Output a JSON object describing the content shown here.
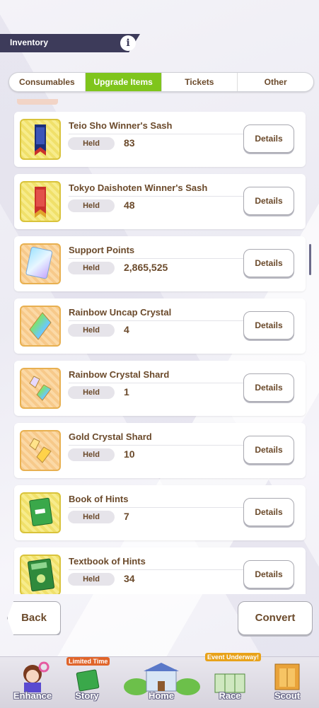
{
  "header": {
    "title": "Inventory",
    "info_icon": "i"
  },
  "tabs": [
    {
      "label": "Consumables",
      "active": false
    },
    {
      "label": "Upgrade Items",
      "active": true
    },
    {
      "label": "Tickets",
      "active": false
    },
    {
      "label": "Other",
      "active": false
    }
  ],
  "accent_color": "#7fc51c",
  "text_color": "#6b4a2b",
  "held_label": "Held",
  "details_label": "Details",
  "items": [
    {
      "name": "Teio Sho Winner's Sash",
      "count": "83",
      "icon": "sash-icon"
    },
    {
      "name": "Tokyo Daishoten Winner's Sash",
      "count": "48",
      "icon": "sash-icon"
    },
    {
      "name": "Support Points",
      "count": "2,865,525",
      "icon": "support-card-icon"
    },
    {
      "name": "Rainbow Uncap Crystal",
      "count": "4",
      "icon": "crystal-icon"
    },
    {
      "name": "Rainbow Crystal Shard",
      "count": "1",
      "icon": "crystal-shard-icon"
    },
    {
      "name": "Gold Crystal Shard",
      "count": "10",
      "icon": "gold-shard-icon"
    },
    {
      "name": "Book of Hints",
      "count": "7",
      "icon": "book-icon"
    },
    {
      "name": "Textbook of Hints",
      "count": "34",
      "icon": "textbook-icon"
    }
  ],
  "footer": {
    "back_label": "Back",
    "convert_label": "Convert"
  },
  "nav": [
    {
      "label": "Enhance"
    },
    {
      "label": "Story",
      "badge": "Limited Time"
    },
    {
      "label": "Home"
    },
    {
      "label": "Race",
      "badge": "Event Underway!"
    },
    {
      "label": "Scout"
    }
  ]
}
